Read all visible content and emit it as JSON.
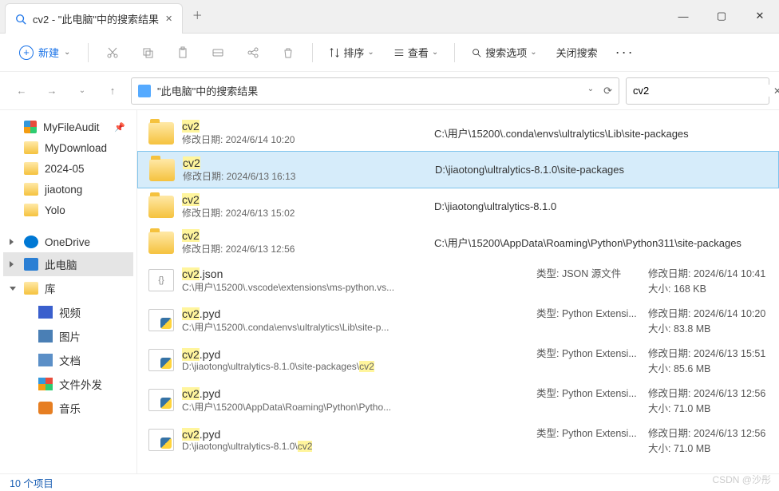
{
  "tab": {
    "title": "cv2 - \"此电脑\"中的搜索结果"
  },
  "toolbar": {
    "new": "新建",
    "sort": "排序",
    "view": "查看",
    "search_options": "搜索选项",
    "close_search": "关闭搜索"
  },
  "breadcrumb": {
    "text": "\"此电脑\"中的搜索结果"
  },
  "search": {
    "value": "cv2"
  },
  "sidebar": {
    "audit": "MyFileAudit",
    "download": "MyDownload",
    "month": "2024-05",
    "jiaotong": "jiaotong",
    "yolo": "Yolo",
    "onedrive": "OneDrive",
    "thispc": "此电脑",
    "lib": "库",
    "video": "视频",
    "image": "图片",
    "doc": "文档",
    "fileext": "文件外发",
    "music": "音乐"
  },
  "labels": {
    "mod_date": "修改日期",
    "type": "类型",
    "size": "大小"
  },
  "results": [
    {
      "name": "cv2",
      "kind": "folder",
      "mod": "2024/6/14 10:20",
      "path": "C:\\用户\\15200\\.conda\\envs\\ultralytics\\Lib\\site-packages"
    },
    {
      "name": "cv2",
      "kind": "folder",
      "mod": "2024/6/13 16:13",
      "path": "D:\\jiaotong\\ultralytics-8.1.0\\site-packages",
      "selected": true
    },
    {
      "name": "cv2",
      "kind": "folder",
      "mod": "2024/6/13 15:02",
      "path": "D:\\jiaotong\\ultralytics-8.1.0"
    },
    {
      "name": "cv2",
      "kind": "folder",
      "mod": "2024/6/13 12:56",
      "path": "C:\\用户\\15200\\AppData\\Roaming\\Python\\Python311\\site-packages"
    },
    {
      "name": "cv2.json",
      "kind": "json",
      "loc": "C:\\用户\\15200\\.vscode\\extensions\\ms-python.vs...",
      "type": "JSON 源文件",
      "mod": "2024/6/14 10:41",
      "size": "168 KB"
    },
    {
      "name": "cv2.pyd",
      "kind": "pyd",
      "loc": "C:\\用户\\15200\\.conda\\envs\\ultralytics\\Lib\\site-p...",
      "type": "Python Extensi...",
      "mod": "2024/6/14 10:20",
      "size": "83.8 MB"
    },
    {
      "name": "cv2.pyd",
      "kind": "pyd",
      "loc": "D:\\jiaotong\\ultralytics-8.1.0\\site-packages\\",
      "loc_hl": "cv2",
      "type": "Python Extensi...",
      "mod": "2024/6/13 15:51",
      "size": "85.6 MB"
    },
    {
      "name": "cv2.pyd",
      "kind": "pyd",
      "loc": "C:\\用户\\15200\\AppData\\Roaming\\Python\\Pytho...",
      "type": "Python Extensi...",
      "mod": "2024/6/13 12:56",
      "size": "71.0 MB"
    },
    {
      "name": "cv2.pyd",
      "kind": "pyd",
      "loc": "D:\\jiaotong\\ultralytics-8.1.0\\",
      "loc_hl": "cv2",
      "type": "Python Extensi...",
      "mod": "2024/6/13 12:56",
      "size": "71.0 MB"
    }
  ],
  "status": "10 个项目",
  "watermark": "CSDN @沙彤"
}
